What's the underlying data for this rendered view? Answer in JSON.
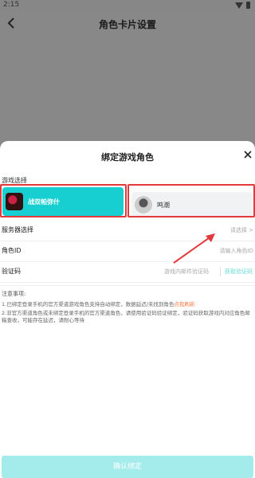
{
  "status_bar": {
    "time": "2:15"
  },
  "header": {
    "title": "角色卡片设置"
  },
  "sheet": {
    "title": "绑定游戏角色",
    "section_label": "游戏选择",
    "games": [
      {
        "name": "战双帕弥什",
        "selected": true
      },
      {
        "name": "鸣潮",
        "selected": false
      }
    ],
    "rows": {
      "server": {
        "label": "服务器选择",
        "value": "请选择 >"
      },
      "role_id": {
        "label": "角色ID",
        "placeholder": "请输入角色ID"
      },
      "code": {
        "label": "验证码",
        "placeholder": "游戏内邮件验证码",
        "button": "获取验证码"
      }
    },
    "notes": {
      "title": "注意事项:",
      "item1_text": "1.已绑定登录手机的官方渠道游戏角色支持自动绑定，数据延迟/未找到角色",
      "item1_link": "点我刷新",
      "item2_text": "2.非官方渠道角色或未绑定登录手机的官方渠道角色，请使用验证码验证绑定，验证码获取游戏内对应角色邮箱查收，可能存在延迟，请耐心等待"
    },
    "confirm_label": "确认绑定"
  },
  "colors": {
    "accent": "#17cfd0",
    "highlight": "#e4393c",
    "confirm_disabled": "#a4ecec"
  }
}
